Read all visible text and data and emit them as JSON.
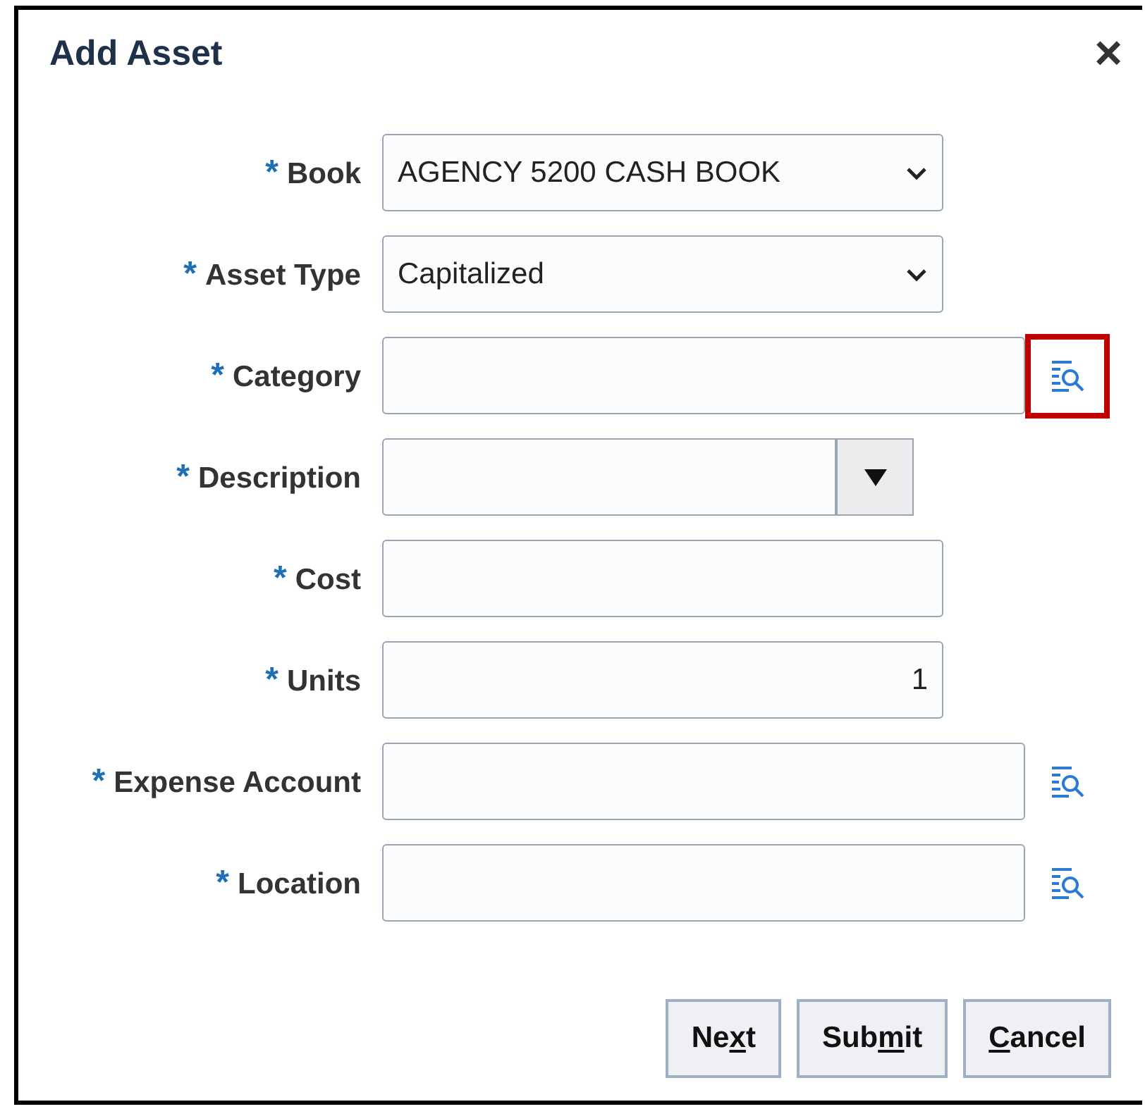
{
  "dialog": {
    "title": "Add Asset",
    "close": "×"
  },
  "fields": [
    {
      "mark": "*",
      "label": "Book",
      "kind": "select",
      "value": "AGENCY 5200 CASH BOOK"
    },
    {
      "mark": "*",
      "label": "Asset Type",
      "kind": "select",
      "value": "Capitalized"
    },
    {
      "mark": "*",
      "label": "Category",
      "kind": "lookup",
      "highlighted": true
    },
    {
      "mark": "*",
      "label": "Description",
      "kind": "combo"
    },
    {
      "mark": "*",
      "label": "Cost",
      "kind": "text"
    },
    {
      "mark": "*",
      "label": "Units",
      "kind": "number",
      "value": "1"
    },
    {
      "mark": "*",
      "label": "Expense Account",
      "kind": "lookup",
      "highlighted": false
    },
    {
      "mark": "*",
      "label": "Location",
      "kind": "lookup",
      "highlighted": false
    }
  ],
  "buttons": [
    {
      "before": "Ne",
      "key": "x",
      "after": "t"
    },
    {
      "before": "Sub",
      "key": "m",
      "after": "it"
    },
    {
      "key": "C",
      "after": "ancel"
    }
  ]
}
